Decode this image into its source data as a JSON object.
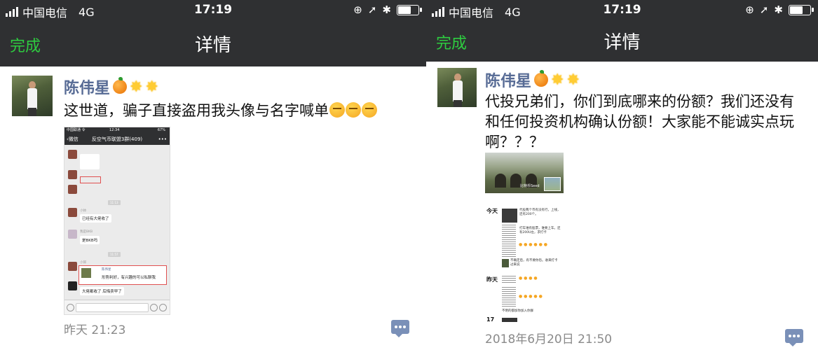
{
  "status_left": {
    "carrier": "中国电信",
    "network": "4G",
    "time": "17:19"
  },
  "status_right": {
    "carrier": "中国电信",
    "network": "4G",
    "time": "17:19"
  },
  "nav_left": {
    "done_label": "完成",
    "title": "详情"
  },
  "nav_right": {
    "done_label": "完成",
    "title": "详情"
  },
  "post_left": {
    "author": "陈伟星",
    "text": "这世道，骗子直接盗用我头像与名字喊单",
    "timestamp": "昨天 21:23",
    "embedded": {
      "status": "中国联通 令",
      "time": "12:34",
      "battery": "67%",
      "back_label": "微信",
      "group_title": "反空气币联盟3群(409)",
      "sender_1": "小帅",
      "msg_1": "已经有大佬收了",
      "sender_2": "我是BKB",
      "msg_2": "是BKB吗",
      "sender_3": "小邱",
      "quoted_author": "陈伟星",
      "quoted_text": "形势利好，有兴趣的可以私聊我",
      "msg_4": "大佬都收了 后悔卖早了"
    }
  },
  "post_right": {
    "author": "陈伟星",
    "text": "代投兄弟们，你们到底哪来的份额？我们还没有和任何投资机构确认份额！大家能不能诚实点玩啊？？？",
    "timestamp": "2018年6月20日 21:50",
    "embedded": {
      "photo_caption": "比特币Seed",
      "day_1": "今天",
      "day_2": "昨天",
      "day_3": "17",
      "note_1": "代投两个币有没有行，上线，还有200个。",
      "note_2": "打车谁有股票，谁要上车。还有200U左，求打卡",
      "note_3": "不确定后，有不要你恐。收来打卡过来说",
      "note_4": "不明的都加你加入你群"
    }
  }
}
